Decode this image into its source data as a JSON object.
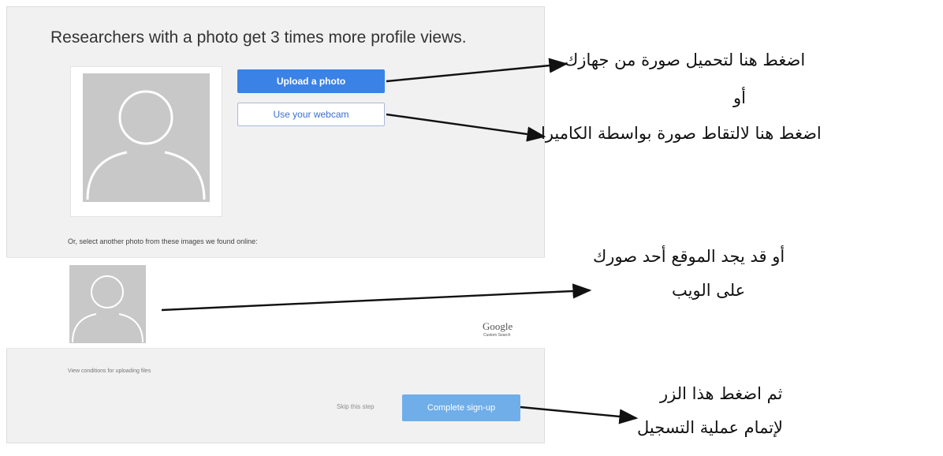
{
  "panel": {
    "headline": "Researchers with a photo get 3 times more profile views.",
    "upload_label": "Upload a photo",
    "webcam_label": "Use your webcam",
    "or_select_text": "Or, select another photo from these images we found online:",
    "google_logo": "Google",
    "google_sub": "Custom Search",
    "conditions_link": "View conditions for uploading files",
    "skip_label": "Skip this step",
    "complete_label": "Complete sign-up"
  },
  "annotations": {
    "upload_hint": "اضغط هنا لتحميل صورة من جهازك",
    "or_word": "أو",
    "webcam_hint": "اضغط هنا لالتقاط صورة بواسطة الكاميرا",
    "web_hint_line1": "أو قد يجد الموقع أحد صورك",
    "web_hint_line2": "على الويب",
    "complete_hint_line1": "ثم اضغط هذا الزر",
    "complete_hint_line2": "لإتمام عملية التسجيل"
  },
  "colors": {
    "accent": "#3b82e6",
    "complete_button": "#70aee9",
    "panel_bg": "#f1f1f1",
    "placeholder": "#c8c8c8"
  }
}
